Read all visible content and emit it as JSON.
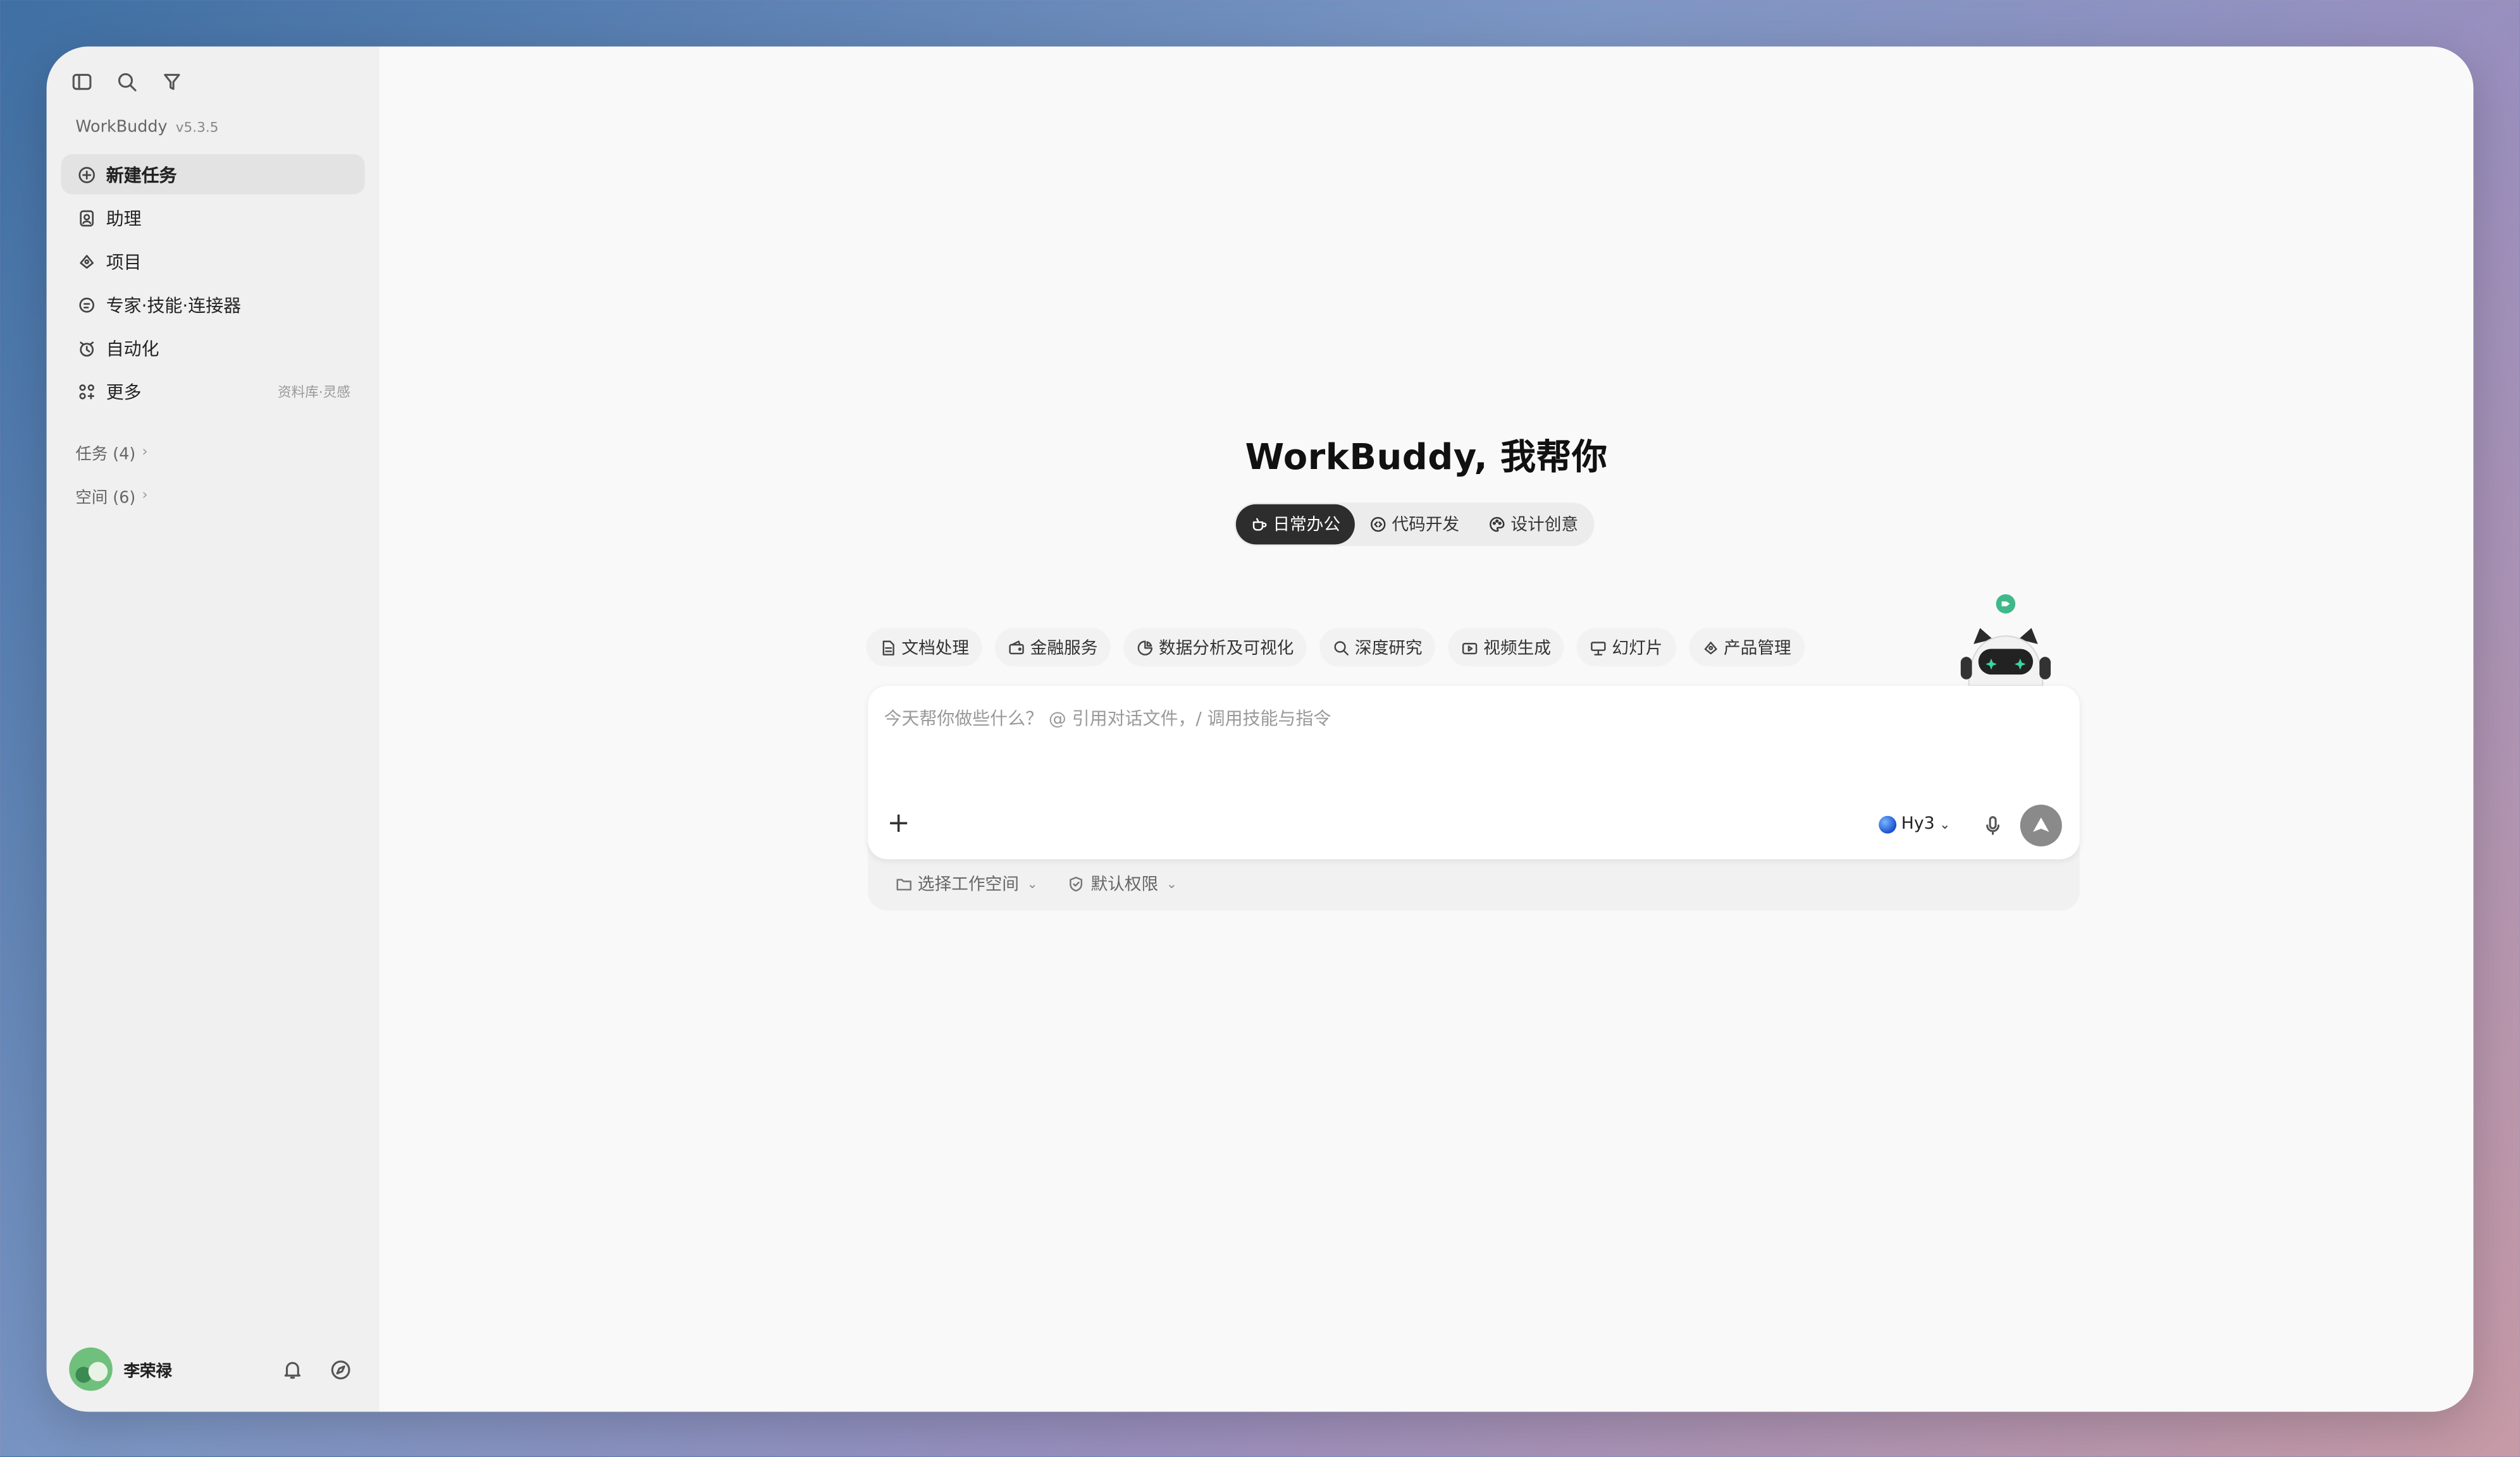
{
  "app": {
    "name": "WorkBuddy",
    "version": "v5.3.5"
  },
  "sidebar": {
    "items": [
      {
        "label": "新建任务",
        "icon": "plus-circle-icon",
        "active": true
      },
      {
        "label": "助理",
        "icon": "assistant-icon"
      },
      {
        "label": "项目",
        "icon": "project-icon"
      },
      {
        "label": "专家·技能·连接器",
        "icon": "expert-icon"
      },
      {
        "label": "自动化",
        "icon": "clock-icon"
      },
      {
        "label": "更多",
        "icon": "grid-icon",
        "right": "资料库·灵感"
      }
    ],
    "groups": [
      {
        "label": "任务 (4)"
      },
      {
        "label": "空间 (6)"
      }
    ]
  },
  "user": {
    "name": "李荣禄"
  },
  "main": {
    "title": "WorkBuddy, 我帮你",
    "modes": [
      {
        "label": "日常办公",
        "icon": "cup-icon",
        "active": true
      },
      {
        "label": "代码开发",
        "icon": "code-icon"
      },
      {
        "label": "设计创意",
        "icon": "palette-icon"
      }
    ],
    "chips": [
      {
        "label": "文档处理",
        "icon": "document-icon"
      },
      {
        "label": "金融服务",
        "icon": "wallet-icon"
      },
      {
        "label": "数据分析及可视化",
        "icon": "pie-chart-icon"
      },
      {
        "label": "深度研究",
        "icon": "search-icon"
      },
      {
        "label": "视频生成",
        "icon": "video-icon"
      },
      {
        "label": "幻灯片",
        "icon": "presentation-icon"
      },
      {
        "label": "产品管理",
        "icon": "product-icon"
      }
    ],
    "input": {
      "placeholder": "今天帮你做些什么？ @ 引用对话文件，/ 调用技能与指令",
      "model": "Hy3"
    },
    "below": {
      "workspace": "选择工作空间",
      "permission": "默认权限"
    }
  }
}
